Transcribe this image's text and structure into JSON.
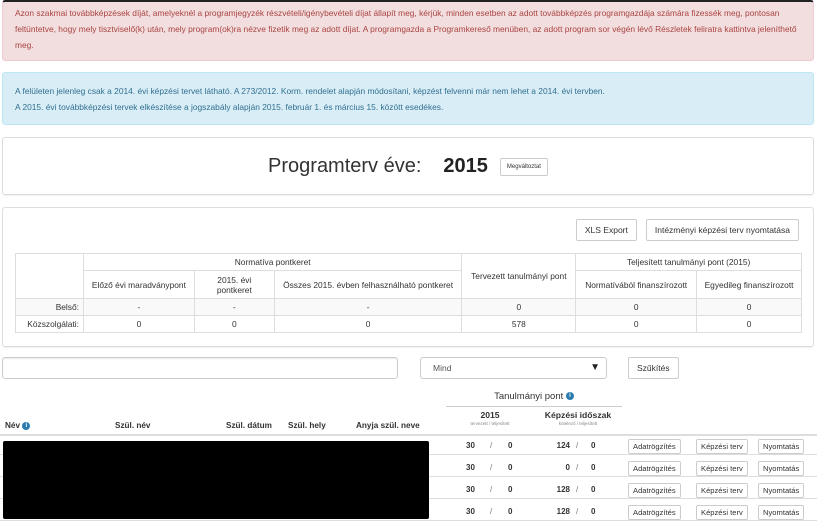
{
  "alerts": {
    "danger": {
      "text": "Azon szakmai továbbképzések díját, amelyeknél a programjegyzék részvételi/igénybevételi díjat állapít meg, kérjük, minden esetben az adott továbbképzés programgazdája számára fizessék meg, pontosan feltüntetve, hogy mely tisztviselő(k) után, mely program(ok)ra nézve fizetik meg az adott díjat. A programgazda a Programkereső menüben, az adott program sor végén lévő Részletek feliratra kattintva jeleníthető meg."
    },
    "info": {
      "line1": "A felületen jelenleg csak a 2014. évi képzési tervet látható. A 273/2012. Korm. rendelet alapján módosítani, képzést felvenni már nem lehet a 2014. évi tervben.",
      "line2": "A 2015. évi továbbképzési tervek elkészítése a jogszabály alapján 2015. február 1. és március 15. között esedékes."
    }
  },
  "year_panel": {
    "label": "Programterv éve:",
    "value": "2015",
    "change_button": "Megváltoztat"
  },
  "summary_panel": {
    "xls_export_button": "XLS Export",
    "print_plan_button": "Intézményi képzési terv nyomtatása",
    "table": {
      "group_normativa": "Normatíva pontkeret",
      "group_tervezett": "Tervezett tanulmányi pont",
      "group_teljesitett": "Teljesített tanulmányi pont (2015)",
      "sub_headers": [
        "Előző évi maradványpont",
        "2015. évi pontkeret",
        "Összes 2015. évben felhasználható pontkeret",
        "Normatívából finanszírozott",
        "Egyedileg finanszírozott"
      ],
      "rows": [
        {
          "label": "Belső:",
          "values": [
            "-",
            "-",
            "-",
            "0",
            "0",
            "0"
          ]
        },
        {
          "label": "Közszolgálati:",
          "values": [
            "0",
            "0",
            "0",
            "578",
            "0",
            "0"
          ]
        }
      ]
    }
  },
  "filters": {
    "search_value": "",
    "select_value": "Mind",
    "filter_button": "Szűkítés"
  },
  "people_table": {
    "headers": {
      "name": "Név",
      "birth_name": "Szül. név",
      "birth_date": "Szül. dátum",
      "birth_place": "Szül. hely",
      "mother_name": "Anyja szül. neve",
      "points_group": "Tanulmányi pont",
      "year": "2015",
      "year_sub": "tervezett / teljesített",
      "period": "Képzési időszak",
      "period_sub": "kötelező / teljesített"
    },
    "rows": [
      {
        "y_planned": "30",
        "y_done": "0",
        "p_required": "124",
        "p_done": "0"
      },
      {
        "y_planned": "30",
        "y_done": "0",
        "p_required": "0",
        "p_done": "0"
      },
      {
        "y_planned": "30",
        "y_done": "0",
        "p_required": "128",
        "p_done": "0"
      },
      {
        "y_planned": "30",
        "y_done": "0",
        "p_required": "128",
        "p_done": "0"
      }
    ],
    "row_buttons": {
      "data_entry": "Adatrögzítés",
      "training_plan": "Képzési terv",
      "print": "Nyomtatás"
    },
    "separator": "/"
  }
}
